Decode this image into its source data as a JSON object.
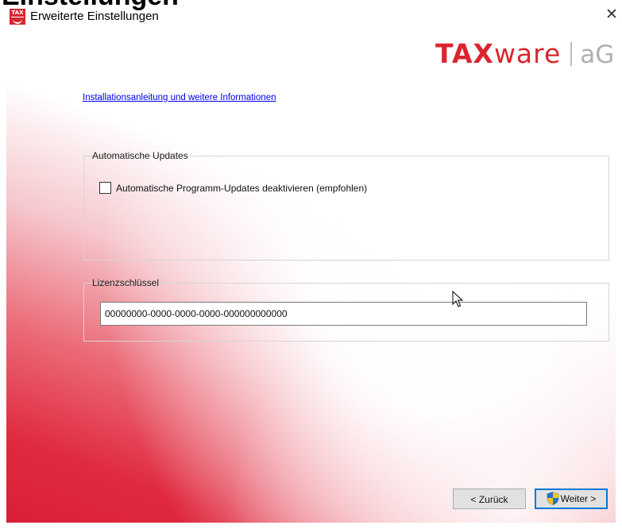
{
  "window": {
    "clipped_heading": "Einstellungen",
    "title": "Erweiterte Einstellungen",
    "close_glyph": "✕",
    "app_icon_text": "TAX"
  },
  "logo": {
    "part1": "TAX",
    "part2": "ware",
    "part3": "aG",
    "brand_color": "#d9262e"
  },
  "links": {
    "install_info": "Installationsanleitung und weitere Informationen"
  },
  "updates_group": {
    "label": "Automatische Updates",
    "checkbox_label": "Automatische Programm-Updates deaktivieren (empfohlen)",
    "checkbox_checked": false
  },
  "license_group": {
    "label": "Lizenzschlüssel",
    "value": "00000000-0000-0000-0000-000000000000"
  },
  "buttons": {
    "back": "< Zurück",
    "next": "Weiter >"
  },
  "icons": {
    "app": "taxware-app-icon",
    "shield": "uac-shield-icon",
    "cursor": "mouse-pointer-icon"
  }
}
